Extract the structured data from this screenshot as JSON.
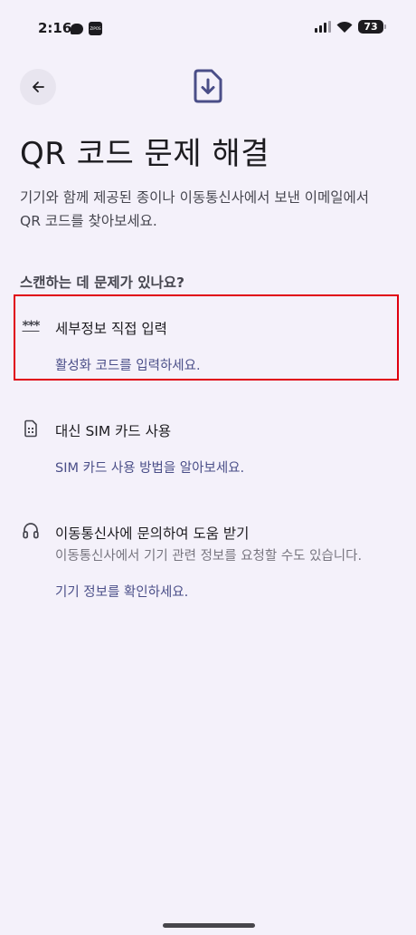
{
  "status_bar": {
    "time": "2:16",
    "battery": "73",
    "app_badge": "ZIPOS"
  },
  "header": {
    "title": "QR 코드 문제 해결",
    "description": "기기와 함께 제공된 종이나 이동통신사에서 보낸 이메일에서 QR 코드를 찾아보세요."
  },
  "section": {
    "heading": "스캔하는 데 문제가 있나요?"
  },
  "options": [
    {
      "icon": "***",
      "title": "세부정보 직접 입력",
      "link": "활성화 코드를 입력하세요."
    },
    {
      "icon": "sim-card-icon",
      "title": "대신 SIM 카드 사용",
      "link": "SIM 카드 사용 방법을 알아보세요."
    },
    {
      "icon": "headset-icon",
      "title": "이동통신사에 문의하여 도움 받기",
      "subtitle": "이동통신사에서 기기 관련 정보를 요청할 수도 있습니다.",
      "link": "기기 정보를 확인하세요."
    }
  ],
  "colors": {
    "background": "#f4f1fa",
    "accent": "#4a4e88",
    "icon": "#4a4e88",
    "highlight": "#e0000f"
  }
}
